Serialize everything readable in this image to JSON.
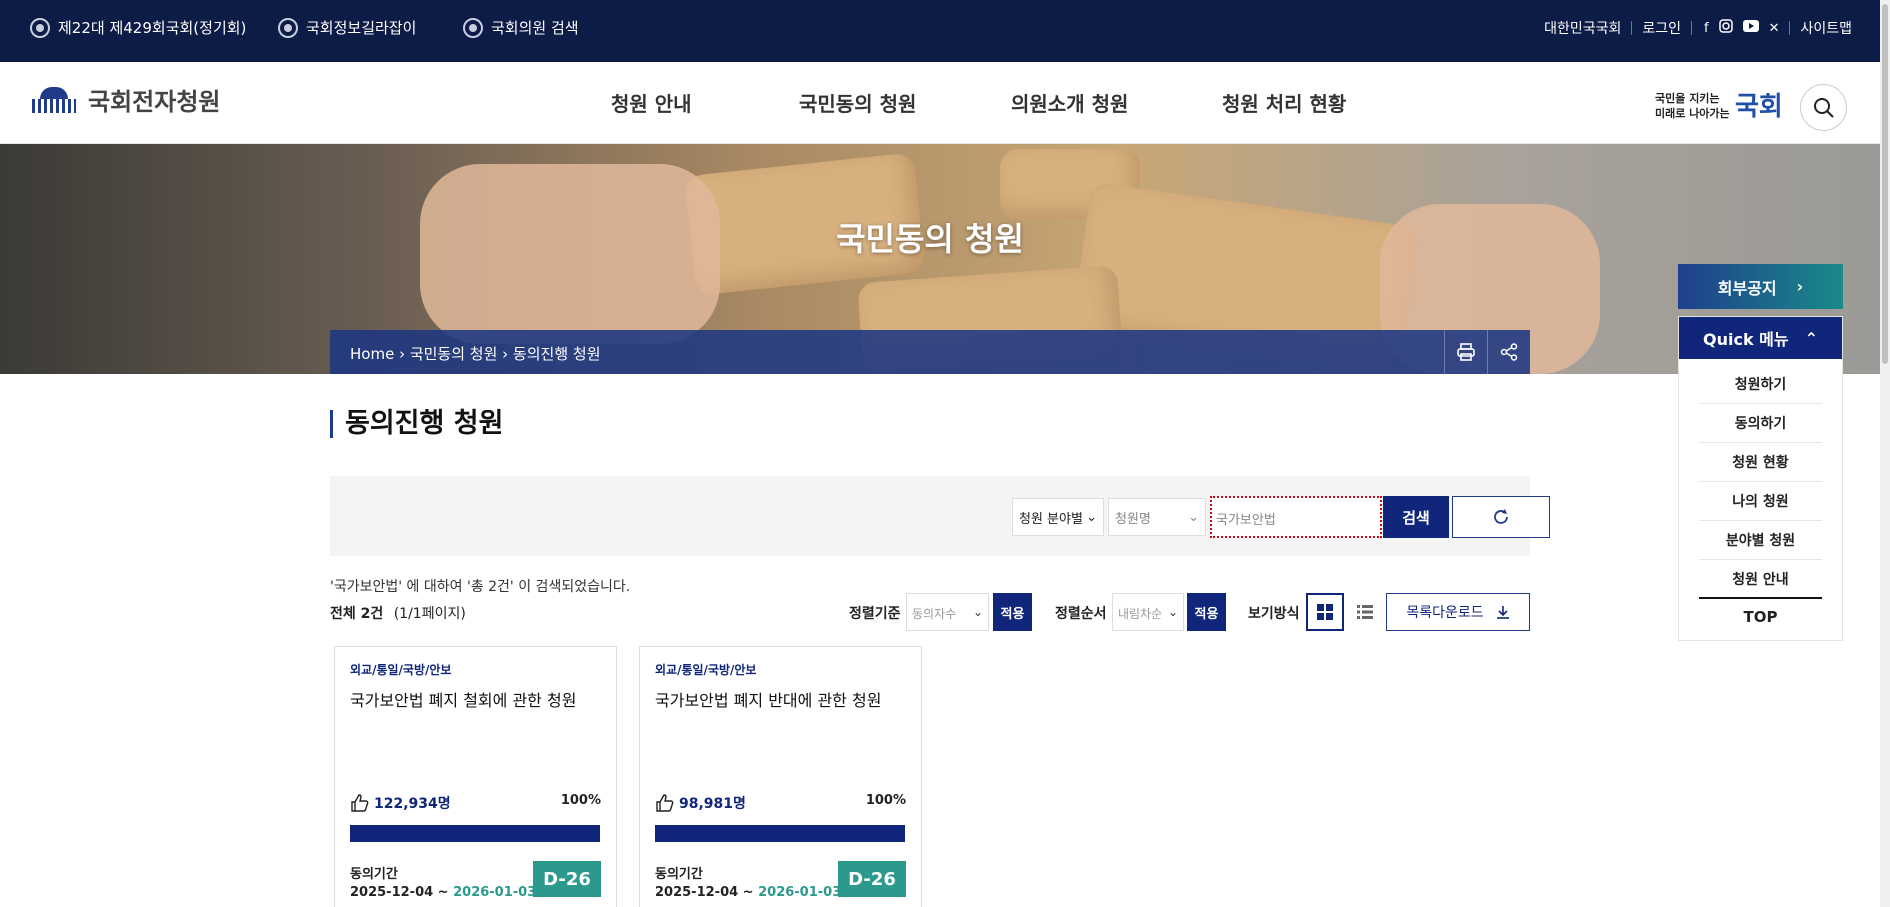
{
  "topbar": {
    "links": [
      "제22대 제429회국회(정기회)",
      "국회정보길라잡이",
      "국회의원 검색"
    ],
    "right": [
      "대한민국국회",
      "로그인",
      "사이트맵"
    ],
    "sns": [
      "facebook-icon",
      "instagram-icon",
      "youtube-icon",
      "x-icon"
    ]
  },
  "header": {
    "logo": "국회전자청원",
    "nav": [
      "청원 안내",
      "국민동의 청원",
      "의원소개 청원",
      "청원 처리 현황"
    ],
    "slogan": {
      "line1": "국민을 지키는",
      "line2": "미래로 나아가는",
      "big": "국회"
    }
  },
  "hero": {
    "title": "국민동의 청원",
    "breadcrumb": "Home › 국민동의 청원 › 동의진행 청원"
  },
  "page": {
    "title": "동의진행 청원",
    "search": {
      "category": "청원 분야별",
      "field": "청원명",
      "query": "국가보안법",
      "button": "검색"
    },
    "result_msg": "'국가보안법' 에 대하여 '총 2건' 이 검색되었습니다.",
    "total_label": "전체 2건",
    "page_info": "(1/1페이지)",
    "sort_label": "정렬기준",
    "sort_value": "동의자수",
    "order_label": "정렬순서",
    "order_value": "내림차순",
    "apply": "적용",
    "view_label": "보기방식",
    "download": "목록다운로드"
  },
  "cards": [
    {
      "category": "외교/통일/국방/안보",
      "title": "국가보안법 폐지 철회에 관한 청원",
      "count": "122,934명",
      "percent": "100%",
      "fill": 1.0,
      "period_label": "동의기간",
      "start": "2025-12-04 ~",
      "end": "2026-01-03",
      "dday": "D-26"
    },
    {
      "category": "외교/통일/국방/안보",
      "title": "국가보안법 폐지 반대에 관한 청원",
      "count": "98,981명",
      "percent": "100%",
      "fill": 1.0,
      "period_label": "동의기간",
      "start": "2025-12-04 ~",
      "end": "2026-01-03",
      "dday": "D-26"
    }
  ],
  "quick": {
    "notice": "회부공지",
    "head": "Quick 메뉴",
    "items": [
      "청원하기",
      "동의하기",
      "청원 현황",
      "나의 청원",
      "분야별 청원",
      "청원 안내"
    ],
    "top": "TOP"
  },
  "colors": {
    "navy": "#0d1b47",
    "primary": "#10267a",
    "teal": "#2b9a8d"
  }
}
